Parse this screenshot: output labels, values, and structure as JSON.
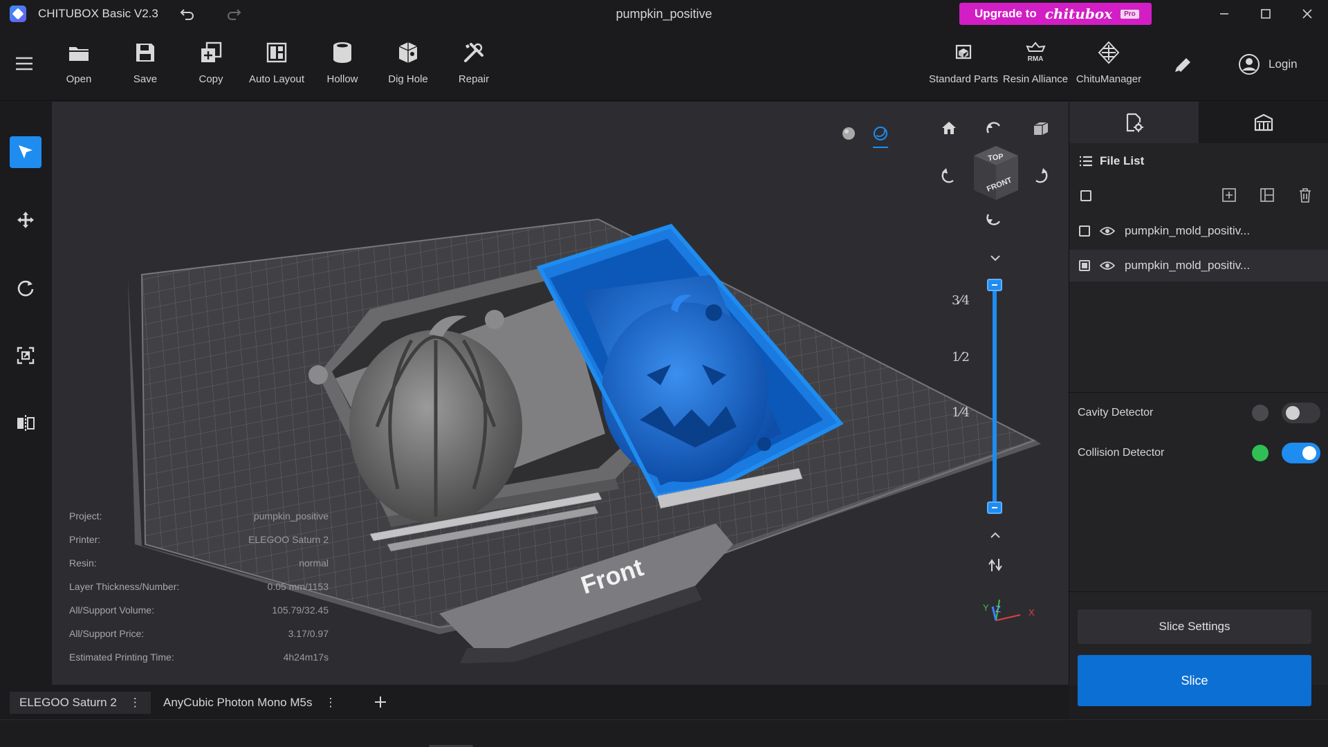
{
  "titlebar": {
    "app_title": "CHITUBOX Basic V2.3",
    "doc_title": "pumpkin_positive",
    "upgrade_prefix": "Upgrade to",
    "upgrade_brand": "chitubox",
    "upgrade_badge": "Pro"
  },
  "toolbar": {
    "open": "Open",
    "save": "Save",
    "copy": "Copy",
    "auto_layout": "Auto Layout",
    "hollow": "Hollow",
    "dig_hole": "Dig Hole",
    "repair": "Repair",
    "standard_parts": "Standard Parts",
    "resin_alliance": "Resin Alliance",
    "rma_text": "RMA",
    "chitumanager": "ChituManager",
    "login": "Login"
  },
  "viewport": {
    "view_cube_top": "TOP",
    "view_cube_front": "FRONT",
    "plate_front_label": "Front",
    "axis_x": "X",
    "axis_y": "Y",
    "axis_z": "Z",
    "layer_fractions": [
      "3⁄4",
      "1⁄2",
      "1⁄4"
    ],
    "layer_position": {
      "low": 0.0,
      "high": 1.0
    }
  },
  "info": {
    "rows": [
      {
        "label": "Project:",
        "value": "pumpkin_positive"
      },
      {
        "label": "Printer:",
        "value": "ELEGOO Saturn 2"
      },
      {
        "label": "Resin:",
        "value": "normal"
      },
      {
        "label": "Layer Thickness/Number:",
        "value": "0.05 mm/1153"
      },
      {
        "label": "All/Support Volume:",
        "value": "105.79/32.45"
      },
      {
        "label": "All/Support Price:",
        "value": "3.17/0.97"
      },
      {
        "label": "Estimated Printing Time:",
        "value": "4h24m17s"
      }
    ]
  },
  "right_panel": {
    "file_list_title": "File List",
    "files": [
      {
        "name": "pumpkin_mold_positiv...",
        "checked": false,
        "selected": false
      },
      {
        "name": "pumpkin_mold_positiv...",
        "checked": true,
        "selected": true
      }
    ],
    "cavity_detector": "Cavity Detector",
    "collision_detector": "Collision Detector",
    "cavity_enabled": false,
    "collision_enabled": true,
    "slice_settings": "Slice Settings",
    "slice": "Slice"
  },
  "printer_tabs": [
    {
      "label": "ELEGOO Saturn 2",
      "active": true
    },
    {
      "label": "AnyCubic Photon Mono M5s",
      "active": false
    }
  ],
  "colors": {
    "accent": "#1f8cf0",
    "upgrade": "#d21ec4",
    "selected_model": "#1677e0",
    "model_grey": "#8a8a8a",
    "detector_ok": "#2fbf54"
  }
}
